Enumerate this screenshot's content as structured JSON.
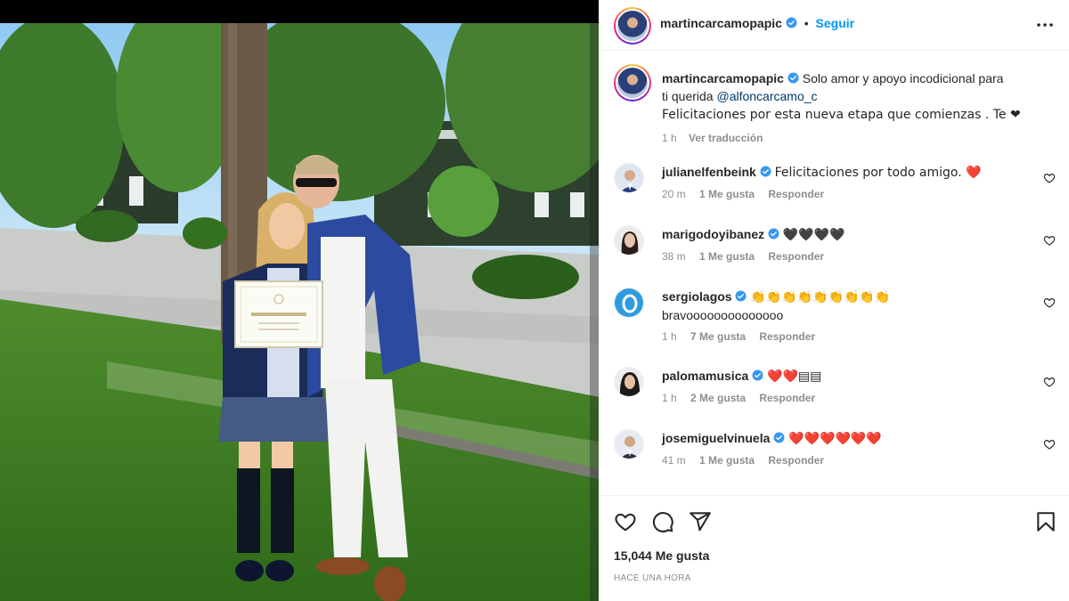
{
  "post": {
    "author": "martincarcamopapic",
    "follow_label": "Seguir",
    "separator": "•",
    "caption_line1": "Solo amor y apoyo incodicional para",
    "caption_line2_prefix": "ti querida",
    "caption_mention": "@alfoncarcamo_c",
    "caption_line3": "Felicitaciones por esta nueva etapa que comienzas . Te ❤",
    "caption_time": "1 h",
    "translate_label": "Ver traducción",
    "likes": "15,044 Me gusta",
    "posted_ago": "HACE UNA HORA"
  },
  "comments": [
    {
      "user": "julianelfenbeink",
      "verified": true,
      "text": "Felicitaciones por todo amigo. ❤️",
      "time": "20 m",
      "likes": "1 Me gusta",
      "reply": "Responder"
    },
    {
      "user": "marigodoyibanez",
      "verified": true,
      "text": "🖤🖤🖤🖤",
      "time": "38 m",
      "likes": "1 Me gusta",
      "reply": "Responder"
    },
    {
      "user": "sergiolagos",
      "verified": true,
      "text": "👏👏👏👏👏👏👏👏👏",
      "text2": "bravoooooooooooooo",
      "time": "1 h",
      "likes": "7 Me gusta",
      "reply": "Responder"
    },
    {
      "user": "palomamusica",
      "verified": true,
      "text": "❤️❤️▤▤",
      "time": "1 h",
      "likes": "2 Me gusta",
      "reply": "Responder"
    },
    {
      "user": "josemiguelvinuela",
      "verified": true,
      "text": "❤️❤️❤️❤️❤️❤️",
      "time": "41 m",
      "likes": "1 Me gusta",
      "reply": "Responder"
    }
  ],
  "diploma": {
    "text": "Reconocimiento"
  },
  "icons": {
    "more": "more-icon",
    "like": "heart-icon",
    "comment": "comment-icon",
    "share": "share-icon",
    "save": "bookmark-icon",
    "verified": "verified-icon"
  },
  "colors": {
    "follow": "#0095f6",
    "mention": "#00376b",
    "verified": "#3897f0",
    "muted": "#8e8e8e"
  }
}
